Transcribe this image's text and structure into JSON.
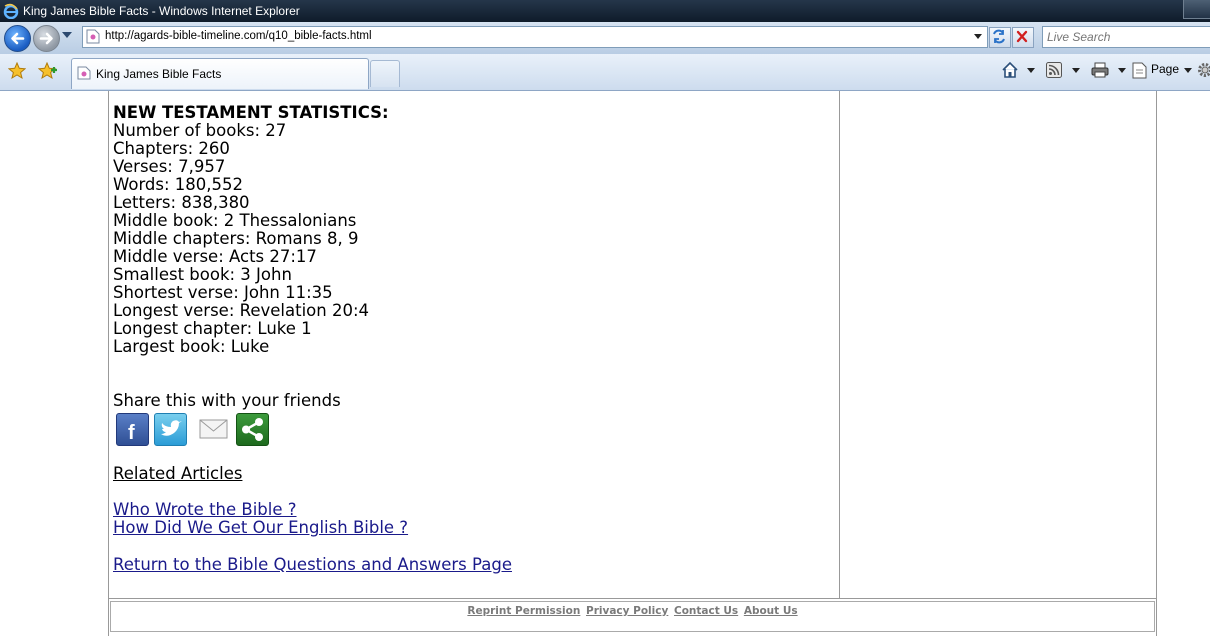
{
  "window": {
    "title": "King James Bible Facts - Windows Internet Explorer"
  },
  "address_bar": {
    "url": "http://agards-bible-timeline.com/q10_bible-facts.html"
  },
  "search": {
    "placeholder": "Live Search"
  },
  "tab": {
    "label": "King James Bible Facts"
  },
  "command_bar": {
    "page_label": "Page"
  },
  "content": {
    "heading": "NEW TESTAMENT STATISTICS:",
    "stats": [
      "Number of books: 27",
      "Chapters: 260",
      "Verses: 7,957",
      "Words: 180,552",
      "Letters: 838,380",
      "Middle book: 2 Thessalonians",
      "Middle chapters: Romans 8, 9",
      "Middle verse: Acts 27:17",
      "Smallest book: 3 John",
      "Shortest verse: John 11:35",
      "Longest verse: Revelation 20:4",
      "Longest chapter: Luke 1",
      "Largest book: Luke"
    ],
    "share_label": "Share this with your friends",
    "share_icons": [
      "facebook-icon",
      "twitter-icon",
      "email-icon",
      "share-icon"
    ],
    "related_heading": "Related Articles",
    "related_links": [
      "Who Wrote the Bible ?",
      "How Did We Get Our English Bible ?"
    ],
    "return_link": "Return to the Bible Questions and Answers Page"
  },
  "footer": {
    "links": [
      "Reprint Permission",
      "Privacy Policy",
      "Contact Us",
      "About Us"
    ]
  },
  "colors": {
    "link": "#1a1a8a",
    "footer_link": "#7a7a7a",
    "ie_chrome": "#c8d8ec"
  }
}
